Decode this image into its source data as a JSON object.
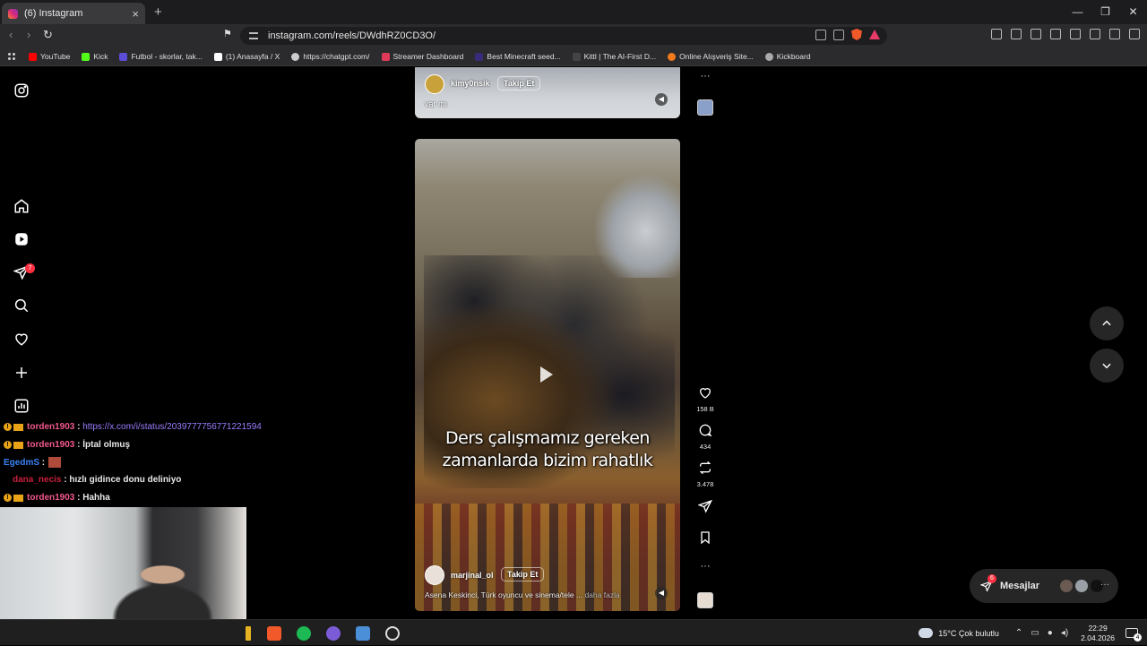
{
  "browser": {
    "tab_title": "(6) Instagram",
    "url": "instagram.com/reels/DWdhRZ0CD3O/",
    "bookmarks": [
      {
        "label": "YouTube",
        "color": "#ff0000"
      },
      {
        "label": "Kick",
        "color": "#53fc18"
      },
      {
        "label": "Futbol - skorlar, tak...",
        "color": "#5b4dd6"
      },
      {
        "label": "(1) Anasayfa / X",
        "color": "#ffffff"
      },
      {
        "label": "https://chatgpt.com/",
        "color": "#cccccc"
      },
      {
        "label": "Streamer Dashboard",
        "color": "#e03a5a"
      },
      {
        "label": "Best Minecraft seed...",
        "color": "#3a2a7a"
      },
      {
        "label": "Kittl | The AI-First D...",
        "color": "#222222"
      },
      {
        "label": "Online Alışveriş Site...",
        "color": "#f27a1a"
      },
      {
        "label": "Kickboard",
        "color": "#aaaaaa"
      }
    ]
  },
  "sidebar": {
    "notifications_badge": "7"
  },
  "reel_top": {
    "username": "kimy0nsik",
    "follow_label": "Takip Et",
    "caption": "var mı"
  },
  "reel_main": {
    "subtitle_line1": "Ders çalışmamız gereken",
    "subtitle_line2": "zamanlarda bizim rahatlık",
    "username": "marjinal_ol",
    "follow_label": "Takip Et",
    "caption": "Asena Keskinci, Türk oyuncu ve sinema/tele ...",
    "more_label": "daha fazla"
  },
  "actions": {
    "likes": "158 B",
    "comments": "434",
    "reposts": "3.478"
  },
  "messages": {
    "label": "Mesajlar",
    "badge": "6"
  },
  "chat": [
    {
      "user": "torden1903",
      "user_color": "#f0588a",
      "badges": true,
      "text": "https://x.com/i/status/2039777756771221594",
      "is_link": true
    },
    {
      "user": "torden1903",
      "user_color": "#f0588a",
      "badges": true,
      "text": "İptal olmuş",
      "is_link": false
    },
    {
      "user": "EgedmS",
      "user_color": "#3b82f6",
      "badges": false,
      "text": "",
      "is_link": false,
      "emote": true
    },
    {
      "user": "dana_necis",
      "user_color": "#c81f3b",
      "badges": false,
      "text": "hızlı gidince donu deliniyo",
      "is_link": false
    },
    {
      "user": "torden1903",
      "user_color": "#f0588a",
      "badges": true,
      "text": "Hahha",
      "is_link": false
    }
  ],
  "taskbar": {
    "weather": "15°C  Çok bulutlu",
    "time": "22:29",
    "date": "2.04.2026",
    "notif_count": "4"
  }
}
